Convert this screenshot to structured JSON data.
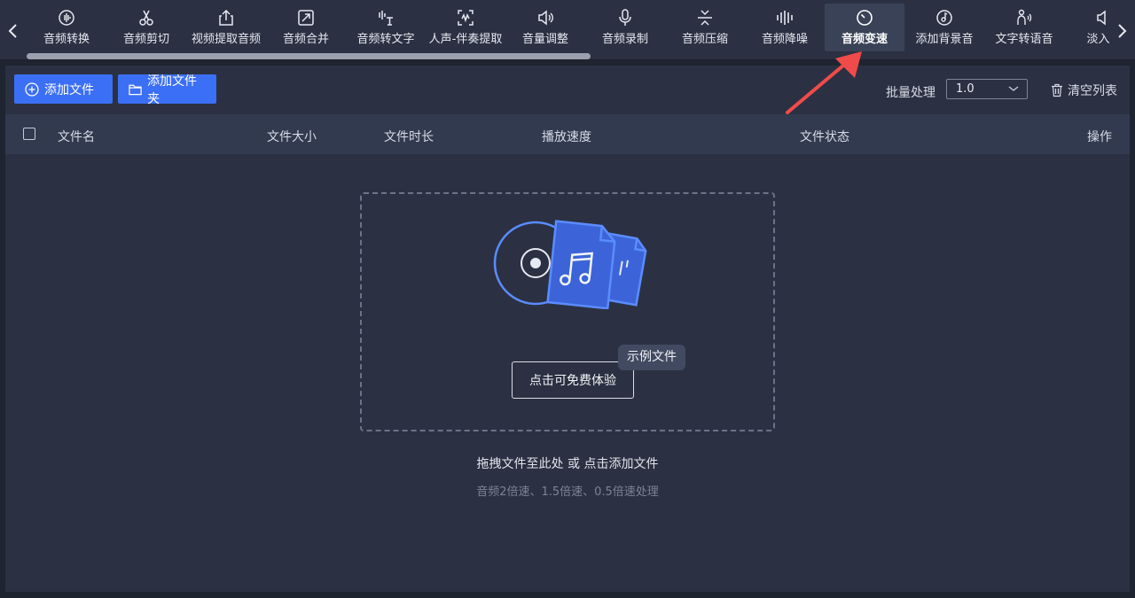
{
  "toolbar": {
    "tools": [
      {
        "label": "音频转换",
        "icon": "waveform-circle-icon"
      },
      {
        "label": "音频剪切",
        "icon": "scissors-icon"
      },
      {
        "label": "视频提取音频",
        "icon": "upload-export-icon"
      },
      {
        "label": "音频合并",
        "icon": "merge-arrows-icon"
      },
      {
        "label": "音频转文字",
        "icon": "voice-to-text-icon"
      },
      {
        "label": "人声-伴奏提取",
        "icon": "vocal-extract-icon"
      },
      {
        "label": "音量调整",
        "icon": "speaker-icon"
      },
      {
        "label": "音频录制",
        "icon": "microphone-icon"
      },
      {
        "label": "音频压缩",
        "icon": "compress-icon"
      },
      {
        "label": "音频降噪",
        "icon": "noise-bars-icon"
      },
      {
        "label": "音频变速",
        "icon": "speed-timer-icon",
        "active": true
      },
      {
        "label": "添加背景音",
        "icon": "music-disc-icon"
      },
      {
        "label": "文字转语音",
        "icon": "text-to-speech-icon"
      },
      {
        "label": "淡入淡",
        "icon": "fade-speaker-icon"
      }
    ]
  },
  "actions": {
    "add_file": "添加文件",
    "add_folder": "添加文件夹",
    "batch_label": "批量处理",
    "batch_value": "1.0",
    "clear_list": "清空列表"
  },
  "table": {
    "columns": [
      "文件名",
      "文件大小",
      "文件时长",
      "播放速度",
      "文件状态",
      "操作"
    ]
  },
  "dropzone": {
    "try_button": "点击可免费体验",
    "sample_tip": "示例文件",
    "hint_main": "拖拽文件至此处 或 点击添加文件",
    "hint_sub": "音频2倍速、1.5倍速、0.5倍速处理"
  },
  "colors": {
    "accent": "#3b6ff5",
    "annotation_arrow": "#f04b4b"
  }
}
